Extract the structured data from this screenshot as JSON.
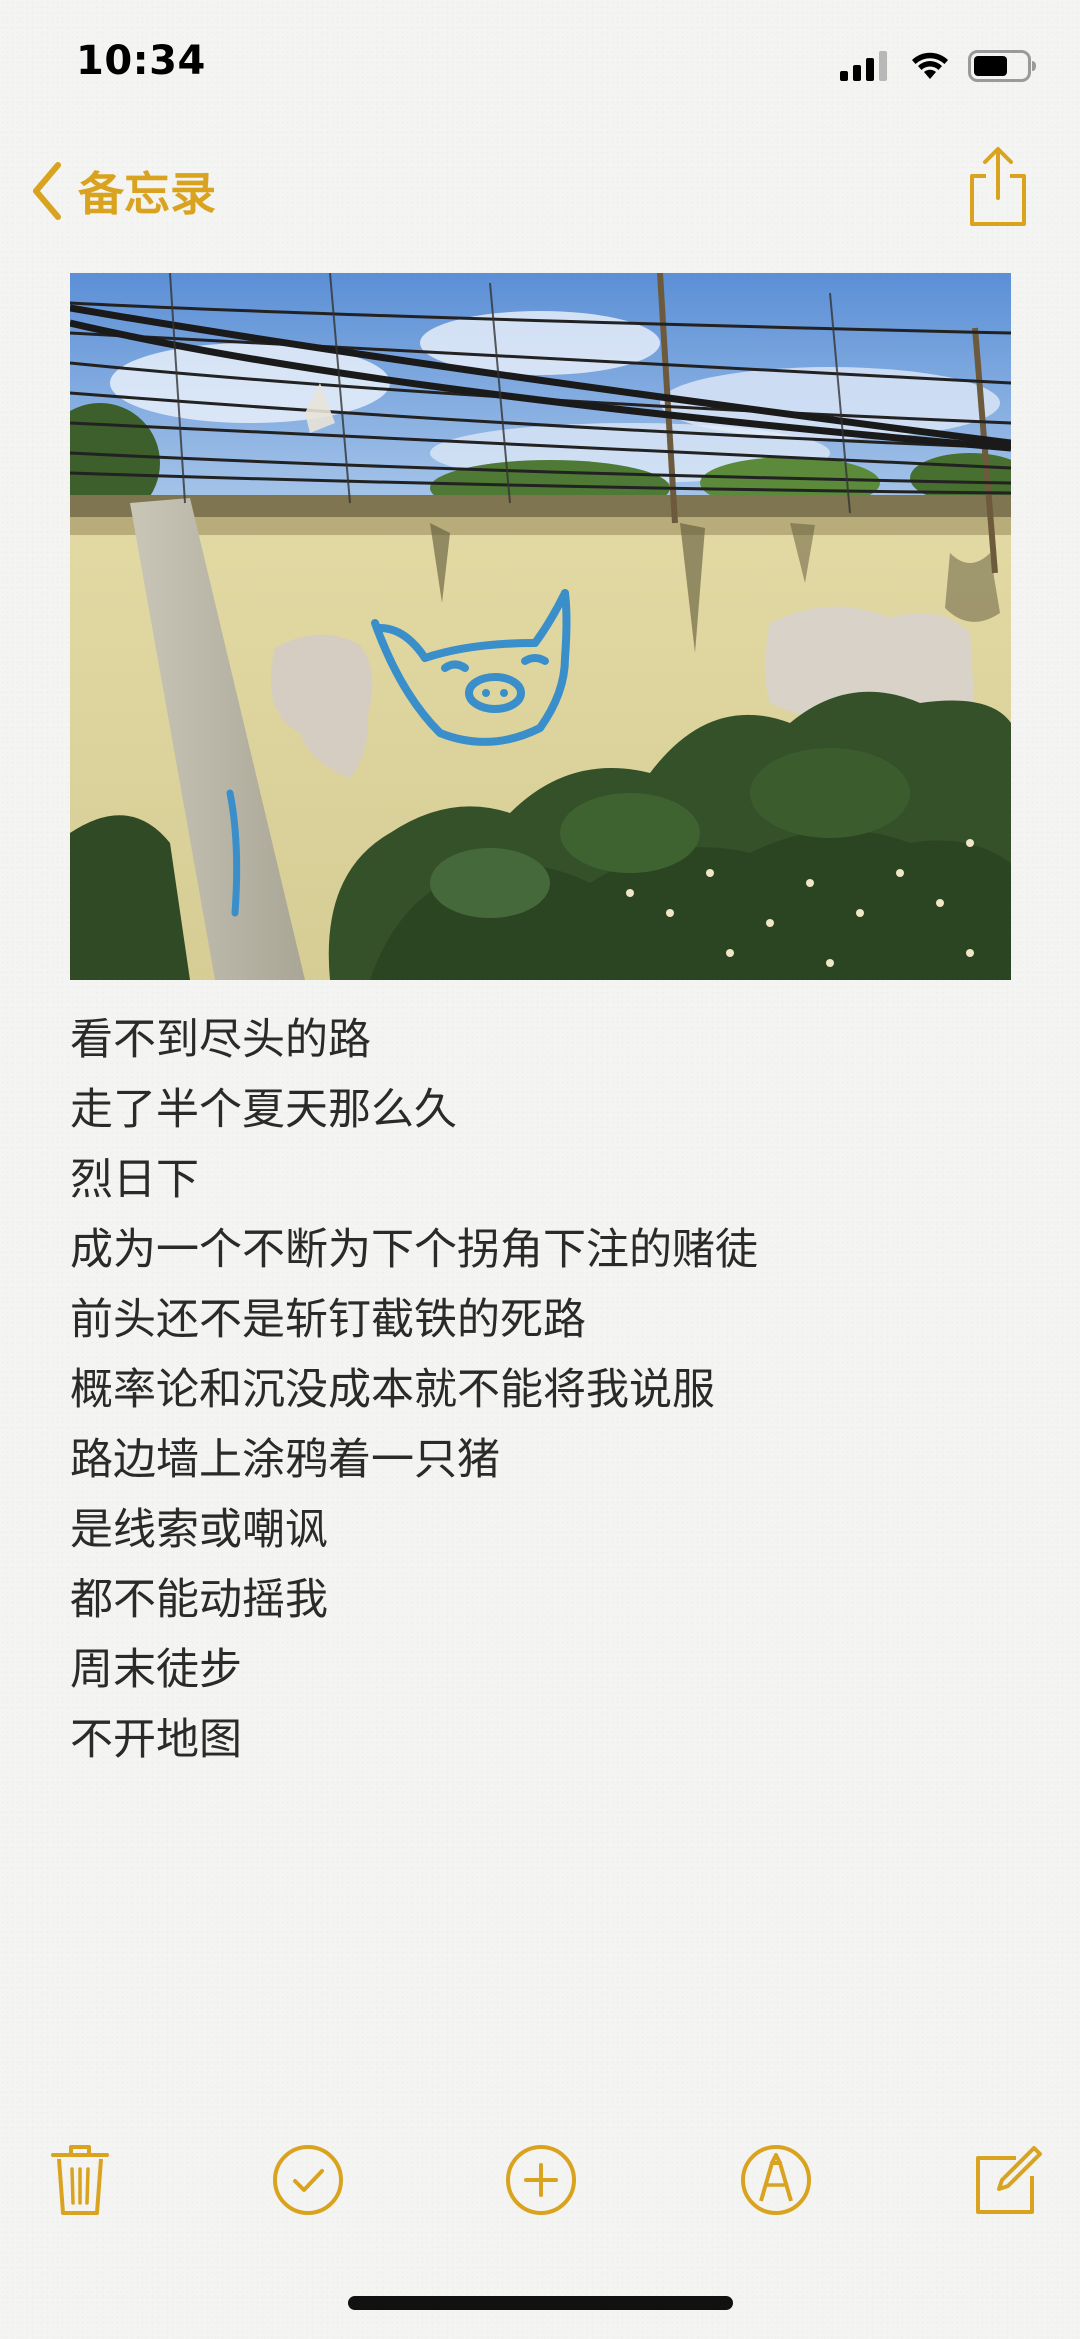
{
  "status_bar": {
    "time": "10:34"
  },
  "nav": {
    "back_label": "备忘录",
    "back_icon": "chevron-left-icon",
    "share_icon": "share-icon"
  },
  "note": {
    "photo_description_icon": "photo",
    "lines": [
      "看不到尽头的路",
      "走了半个夏天那么久",
      "烈日下",
      "成为一个不断为下个拐角下注的赌徒",
      "前头还不是斩钉截铁的死路",
      "概率论和沉没成本就不能将我说服",
      "路边墙上涂鸦着一只猪",
      "是线索或嘲讽",
      "都不能动摇我",
      "周末徒步",
      "不开地图"
    ]
  },
  "toolbar": {
    "items": [
      "trash-icon",
      "checklist-icon",
      "add-icon",
      "markup-icon",
      "compose-icon"
    ]
  },
  "colors": {
    "accent": "#d9a320",
    "text": "#2a2a2a",
    "background": "#f4f4f2"
  }
}
